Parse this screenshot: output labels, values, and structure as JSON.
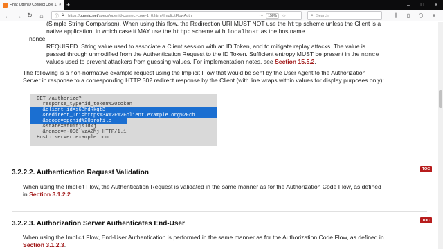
{
  "browser": {
    "tab_title": "Final: OpenID Connect Core 1.0",
    "url_prefix": "https://",
    "url_domain": "openid.net",
    "url_path": "/specs/openid-connect-core-1_0.html#ImplicitFlowAuth",
    "zoom": "150%",
    "search_placeholder": "Search",
    "new_tab": "+"
  },
  "content": {
    "para_top_line1": "(Simple String Comparison). When using this flow, the Redirection URI MUST NOT use the ",
    "para_top_code1": "http",
    "para_top_line1b": " scheme unless the Client is a",
    "para_top_line2a": "native application, in which case it MAY use the ",
    "para_top_code2": "http:",
    "para_top_line2b": " scheme with ",
    "para_top_code3": "localhost",
    "para_top_line2c": " as the hostname.",
    "nonce_term": "nonce",
    "nonce_line1": "REQUIRED. String value used to associate a Client session with an ID Token, and to mitigate replay attacks. The value is",
    "nonce_line2a": "passed through unmodified from the Authentication Request to the ID Token. Sufficient entropy MUST be present in the ",
    "nonce_code": "nonce",
    "nonce_line3a": "values used to prevent attackers from guessing values. For implementation notes, see ",
    "nonce_link": "Section 15.5.2",
    "nonce_line3b": ".",
    "example_line1": "The following is a non-normative example request using the Implicit Flow that would be sent by the User Agent to the Authorization",
    "example_line2": "Server in response to a corresponding HTTP 302 redirect response by the Client (with line wraps within values for display purposes only):",
    "code_lines": [
      "GET /authorize?",
      "  response_type=id_token%20token",
      "  &client_id=s6BhdRkqt3",
      "  &redirect_uri=https%3A%2F%2Fclient.example.org%2Fcb",
      "  &scope=openid%20profile",
      "  &state=af0ifjsldkj",
      "  &nonce=n-0S6_WzA2Mj HTTP/1.1",
      "Host: server.example.com"
    ],
    "section_322_title": "3.2.2.2.  Authentication Request Validation",
    "section_322_line1": "When using the Implicit Flow, the Authentication Request is validated in the same manner as for the Authorization Code Flow, as defined",
    "section_322_line2a": "in ",
    "section_322_link": "Section 3.1.2.2",
    "section_322_line2b": ".",
    "section_323_title": "3.2.2.3.  Authorization Server Authenticates End-User",
    "section_323_line1": "When using the Implicit Flow, End-User Authentication is performed in the same manner as for the Authorization Code Flow, as defined in",
    "section_323_link": "Section 3.1.2.3",
    "section_323_line2b": ".",
    "toc_label": "TOC"
  },
  "colors": {
    "selection": "#1b6fd1",
    "link": "#a11818",
    "toc_badge": "#b71c1c",
    "code_bg": "#d9d9d9"
  },
  "icons": [
    "back-icon",
    "forward-icon",
    "reload-icon",
    "home-icon",
    "lock-icon",
    "more-icon",
    "bookmark-star-icon",
    "search-icon",
    "library-icon",
    "sidebar-icon",
    "menu-icon"
  ]
}
